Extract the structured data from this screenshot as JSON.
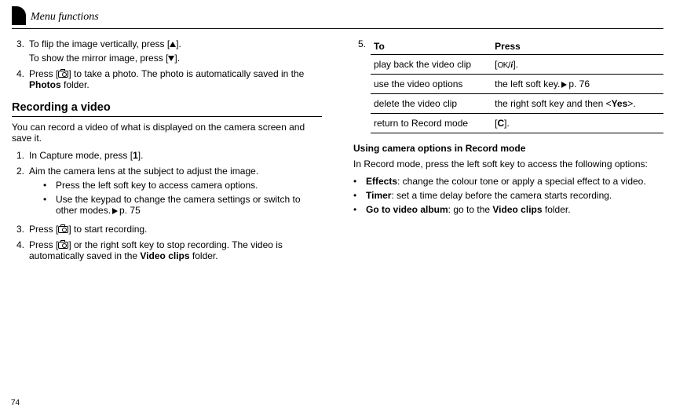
{
  "header": {
    "title": "Menu functions"
  },
  "pageNumber": "74",
  "left": {
    "step3": {
      "num": "3.",
      "line1a": "To flip the image vertically, press [",
      "line1b": "].",
      "line2a": "To show the mirror image, press [",
      "line2b": "]."
    },
    "step4": {
      "num": "4.",
      "a": "Press [",
      "b": "] to take a photo. The photo is automatically saved in the ",
      "bold": "Photos",
      "c": " folder."
    },
    "h2": "Recording a video",
    "intro": "You can record a video of what is displayed on the camera screen and save it.",
    "r1": {
      "num": "1.",
      "a": "In Capture mode, press [",
      "bold": "1",
      "b": "]."
    },
    "r2": {
      "num": "2.",
      "text": "Aim the camera lens at the subject to adjust the image."
    },
    "b1": "Press the left soft key to access camera options.",
    "b2a": "Use the keypad to change the camera settings or switch to other modes.",
    "b2b": "p. 75",
    "r3": {
      "num": "3.",
      "a": "Press [",
      "b": "] to start recording."
    },
    "r4": {
      "num": "4.",
      "a": "Press [",
      "b": "] or the right soft key to stop recording. The video is automatically saved in the ",
      "bold": "Video clips",
      "c": " folder."
    }
  },
  "right": {
    "step5num": "5.",
    "th1": "To",
    "th2": "Press",
    "row1": {
      "to": "play back the video clip",
      "pa": "[",
      "pb": "]."
    },
    "row2": {
      "to": "use the video options",
      "pa": "the left soft key.",
      "pb": "p. 76"
    },
    "row3": {
      "to": "delete the video clip",
      "pa": "the right soft key and then <",
      "bold": "Yes",
      "pb": ">."
    },
    "row4": {
      "to": "return to Record mode",
      "pa": "[",
      "bold": "C",
      "pb": "]."
    },
    "h3": "Using camera options in Record mode",
    "intro": "In Record mode, press the left soft key to access the following options:",
    "opt1": {
      "bold": "Effects",
      "text": ": change the colour tone or apply a special effect to a video."
    },
    "opt2": {
      "bold": "Timer",
      "text": ": set a time delay before the camera starts recording."
    },
    "opt3": {
      "bold": "Go to video album",
      "a": ": go to the ",
      "bold2": "Video clips",
      "b": " folder."
    }
  }
}
